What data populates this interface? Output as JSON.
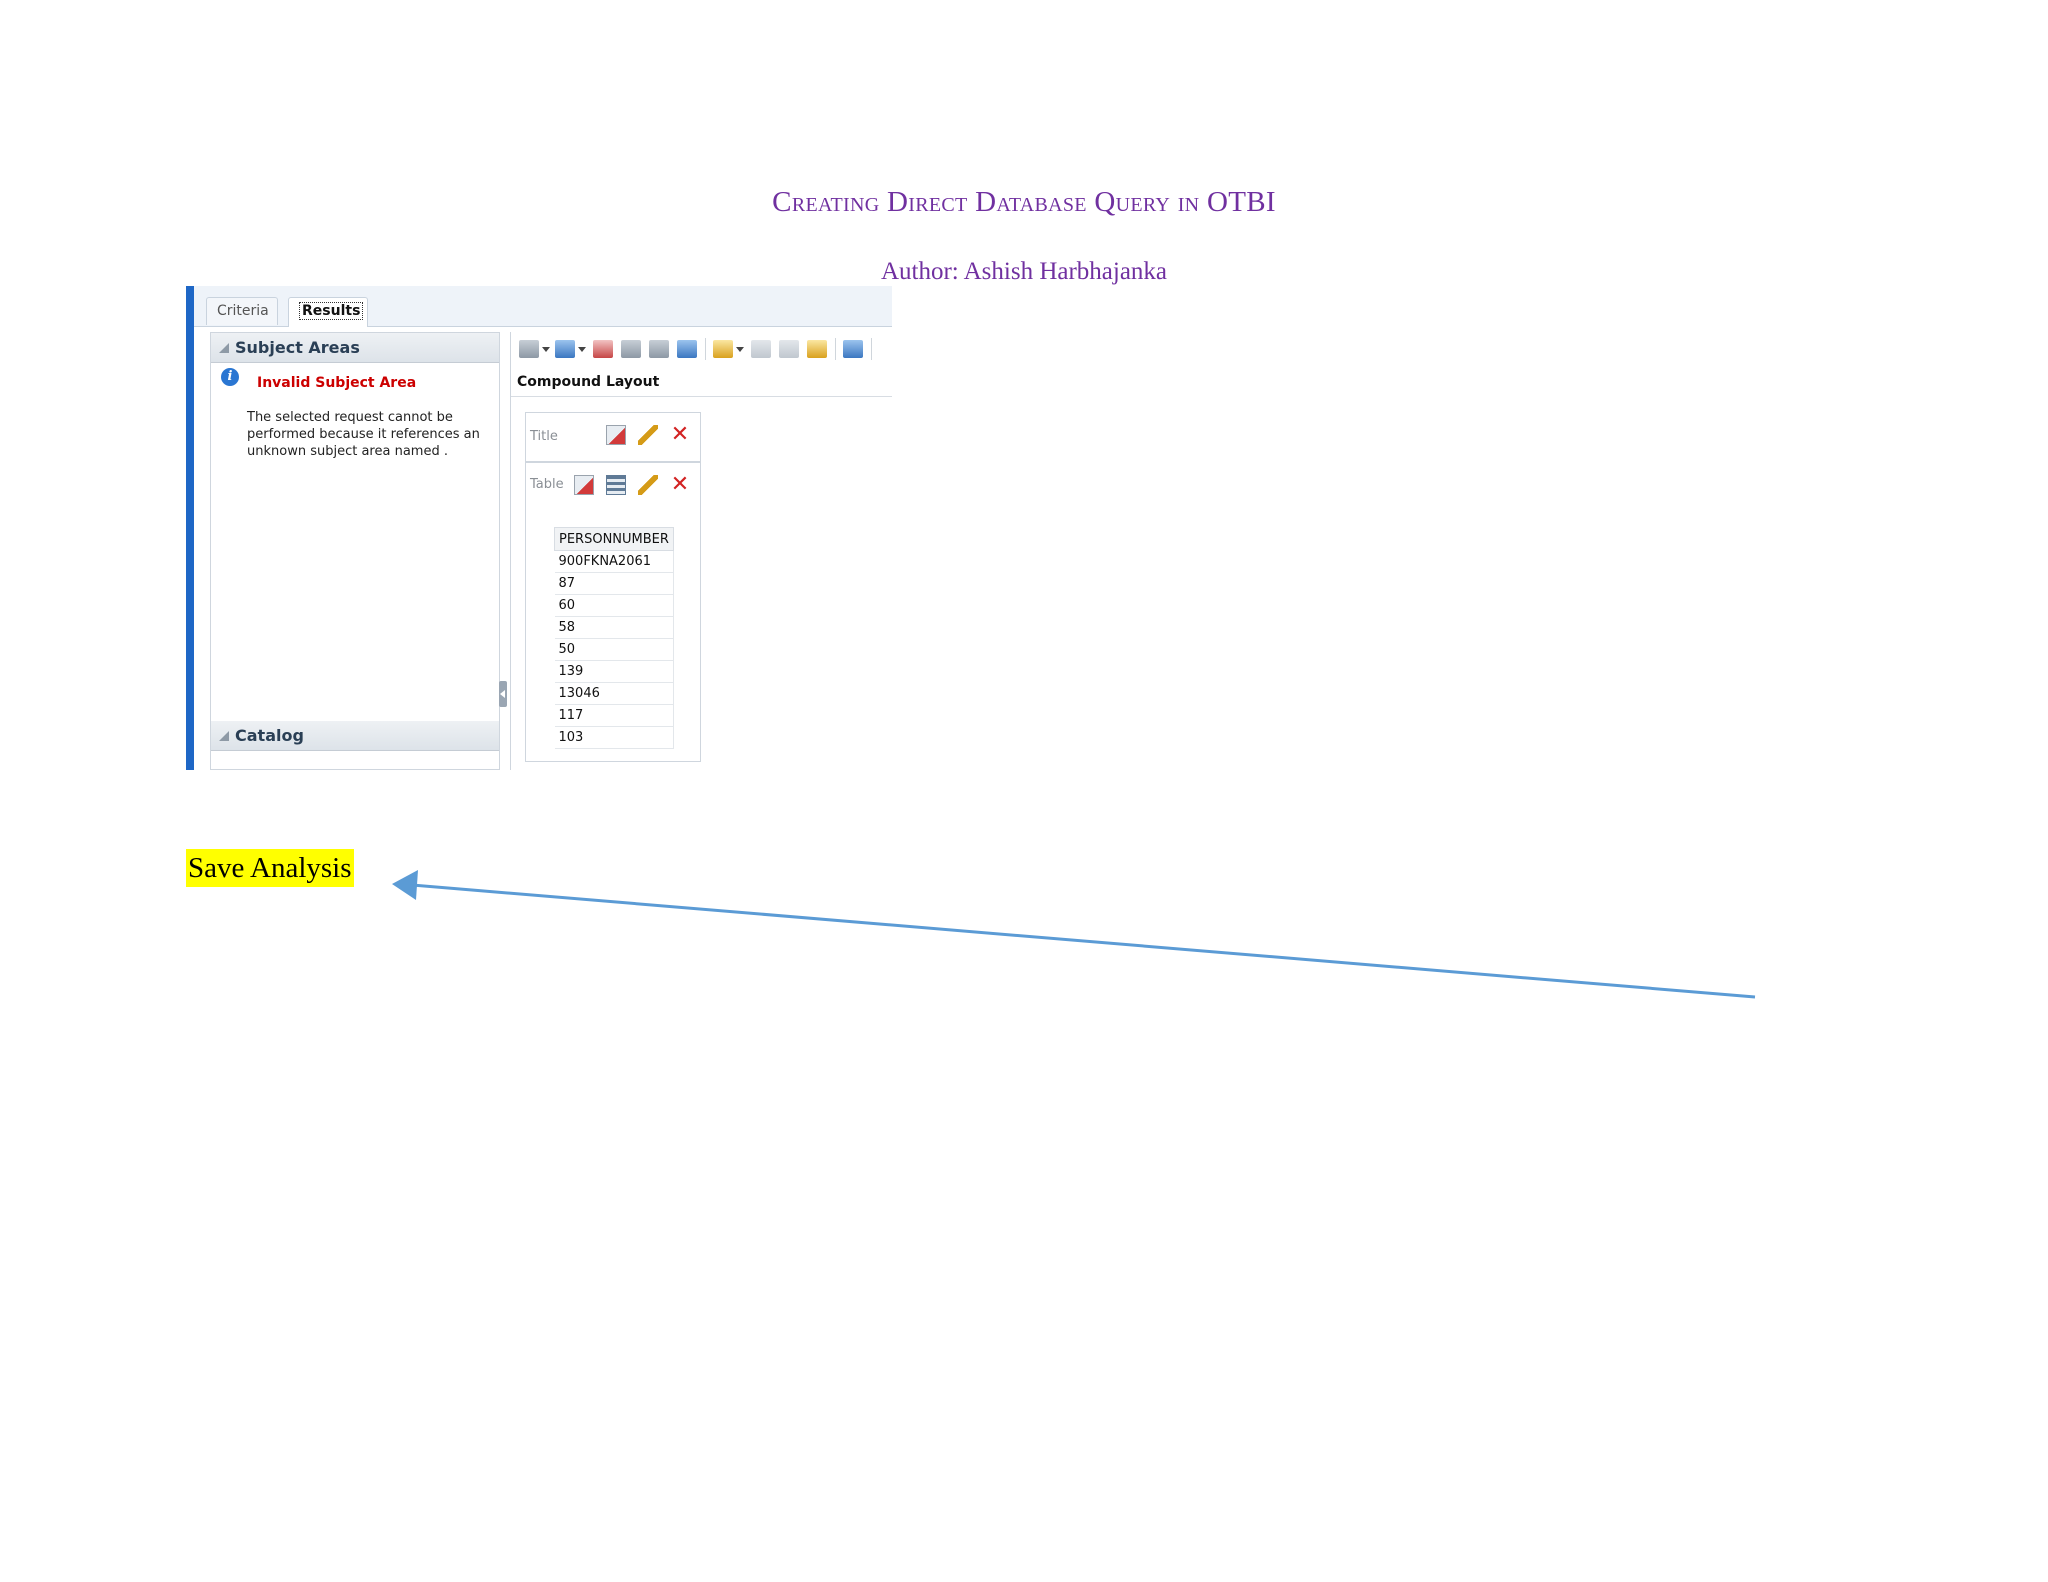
{
  "document": {
    "title": "Creating Direct Database Query in OTBI",
    "author": "Author: Ashish Harbhajanka"
  },
  "screenshot": {
    "tabs": [
      {
        "label": "Criteria",
        "active": false
      },
      {
        "label": "Results",
        "active": true
      }
    ],
    "subject_areas": {
      "header": "Subject Areas",
      "error_title": "Invalid Subject Area",
      "error_message": "The selected request cannot be performed because it references an unknown subject area named ."
    },
    "catalog": {
      "header": "Catalog"
    },
    "toolbar": {
      "icons": [
        "print-icon",
        "export-icon",
        "schedule-icon",
        "preview-icon",
        "refresh-icon",
        "sync-icon",
        "new-view-icon",
        "properties-icon",
        "filter-icon",
        "selection-steps-icon",
        "pivot-icon"
      ]
    },
    "compound_layout": {
      "label": "Compound Layout",
      "title_view": {
        "label": "Title"
      },
      "table_view": {
        "label": "Table",
        "column_header": "PERSONNUMBER",
        "rows": [
          "900FKNA2061",
          "87",
          "60",
          "58",
          "50",
          "139",
          "13046",
          "117",
          "103"
        ]
      }
    },
    "colors": {
      "accent": "#1e67c6",
      "error": "#cc0000"
    }
  },
  "annotation": {
    "label": "Save Analysis",
    "highlight_color": "#ffff00",
    "arrow_color": "#5b9bd5"
  }
}
